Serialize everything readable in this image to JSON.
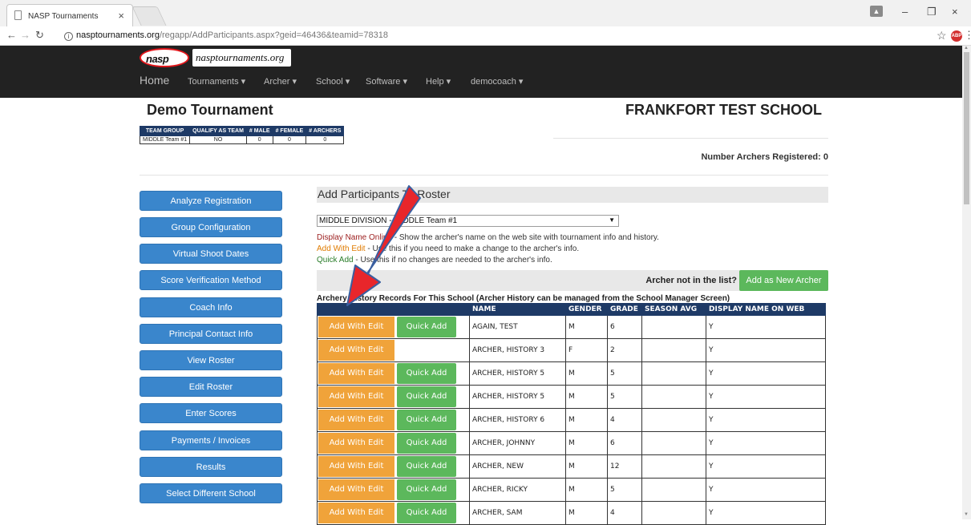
{
  "browser": {
    "tab_title": "NASP Tournaments",
    "tab_close": "×",
    "url_domain": "nasptournaments.org",
    "url_path": "/regapp/AddParticipants.aspx?geid=46436&teamid=78318",
    "window_minimize": "–",
    "window_maximize": "❐",
    "window_close": "×"
  },
  "site": {
    "logo_text": "nasp",
    "logo_wordmark": "nasptournaments.org",
    "nav": {
      "home": "Home",
      "tournaments": "Tournaments ▾",
      "archer": "Archer ▾",
      "school": "School ▾",
      "software": "Software ▾",
      "help": "Help ▾",
      "user": "democoach ▾"
    }
  },
  "page": {
    "tournament_title": "Demo Tournament",
    "school_title": "FRANKFORT TEST SCHOOL",
    "archers_registered": "Number Archers Registered: 0",
    "team_table": {
      "headers": [
        "TEAM GROUP",
        "QUALIFY AS TEAM",
        "# MALE",
        "# FEMALE",
        "# ARCHERS"
      ],
      "row": [
        "MIDDLE Team #1",
        "NO",
        "0",
        "0",
        "0"
      ]
    }
  },
  "sidebar": {
    "items": [
      "Analyze Registration",
      "Group Configuration",
      "Virtual Shoot Dates",
      "Score Verification Method",
      "Coach Info",
      "Principal Contact Info",
      "View Roster",
      "Edit Roster",
      "Enter Scores",
      "Payments / Invoices",
      "Results",
      "Select Different School"
    ]
  },
  "main": {
    "section_title": "Add Participants To Roster",
    "roster_select_value": "MIDDLE DIVISION - MIDDLE Team #1",
    "legend": {
      "display_key": "Display Name Online",
      "display_desc": " - Show the archer's name on the web site with tournament info and history.",
      "edit_key": "Add With Edit",
      "edit_desc": " - Use this if you need to make a change to the archer's info.",
      "quick_key": "Quick Add",
      "quick_desc": " - Use this if no changes are needed to the archer's info."
    },
    "not_in_list": "Archer not in the list?",
    "add_new_archer": "Add as New Archer",
    "records_caption": "Archery History Records For This School (Archer History can be managed from the School Manager Screen)",
    "btn_edit_label": "Add With Edit",
    "btn_quick_label": "Quick Add",
    "columns": [
      "",
      "NAME",
      "GENDER",
      "GRADE",
      "SEASON AVG",
      "DISPLAY NAME ON WEB"
    ],
    "rows": [
      {
        "name": "AGAIN, TEST",
        "gender": "M",
        "grade": "6",
        "avg": "",
        "display": "Y",
        "quick": true
      },
      {
        "name": "ARCHER, HISTORY 3",
        "gender": "F",
        "grade": "2",
        "avg": "",
        "display": "Y",
        "quick": false
      },
      {
        "name": "ARCHER, HISTORY 5",
        "gender": "M",
        "grade": "5",
        "avg": "",
        "display": "Y",
        "quick": true
      },
      {
        "name": "ARCHER, HISTORY 5",
        "gender": "M",
        "grade": "5",
        "avg": "",
        "display": "Y",
        "quick": true
      },
      {
        "name": "ARCHER, HISTORY 6",
        "gender": "M",
        "grade": "4",
        "avg": "",
        "display": "Y",
        "quick": true
      },
      {
        "name": "ARCHER, JOHNNY",
        "gender": "M",
        "grade": "6",
        "avg": "",
        "display": "Y",
        "quick": true
      },
      {
        "name": "ARCHER, NEW",
        "gender": "M",
        "grade": "12",
        "avg": "",
        "display": "Y",
        "quick": true
      },
      {
        "name": "ARCHER, RICKY",
        "gender": "M",
        "grade": "5",
        "avg": "",
        "display": "Y",
        "quick": true
      },
      {
        "name": "ARCHER, SAM",
        "gender": "M",
        "grade": "4",
        "avg": "",
        "display": "Y",
        "quick": true
      }
    ]
  },
  "colors": {
    "header_bg": "#222222",
    "sidebar_btn": "#3a86cc",
    "table_header": "#1e3a66",
    "edit_btn": "#f0a33a",
    "quick_btn": "#5cb85c",
    "arrow": "#e8262b"
  }
}
